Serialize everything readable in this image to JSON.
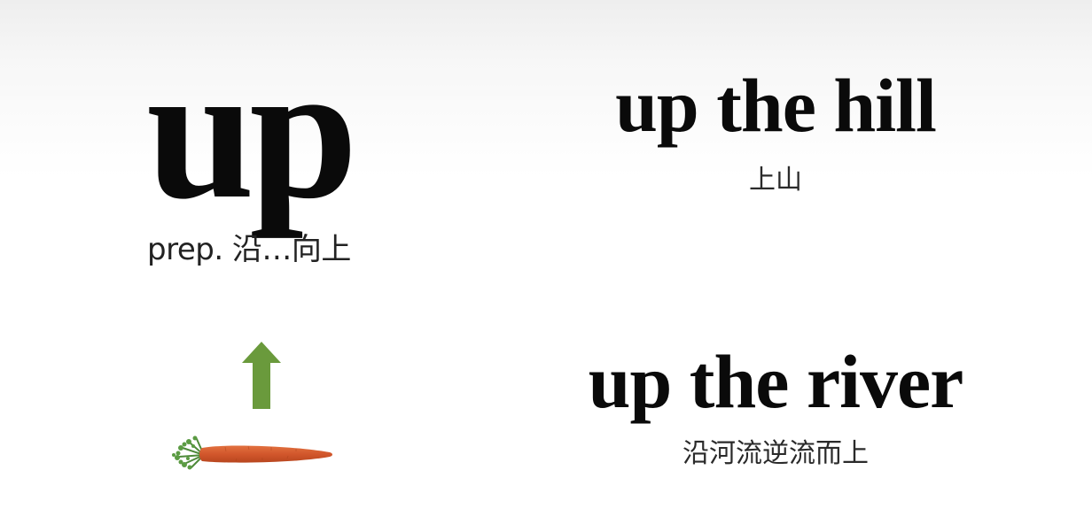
{
  "slide": {
    "word": "up",
    "definition": "prep. 沿…向上",
    "phrases": [
      {
        "english": "up the hill",
        "chinese": "上山"
      },
      {
        "english": "up the river",
        "chinese": "沿河流逆流而上"
      }
    ]
  },
  "illustration": {
    "arrow_icon": "up-arrow-icon",
    "arrow_color": "#6a9a3c",
    "carrot_icon": "carrot-icon",
    "carrot_color": "#d2572c",
    "carrot_top_color": "#4e8a3a"
  }
}
